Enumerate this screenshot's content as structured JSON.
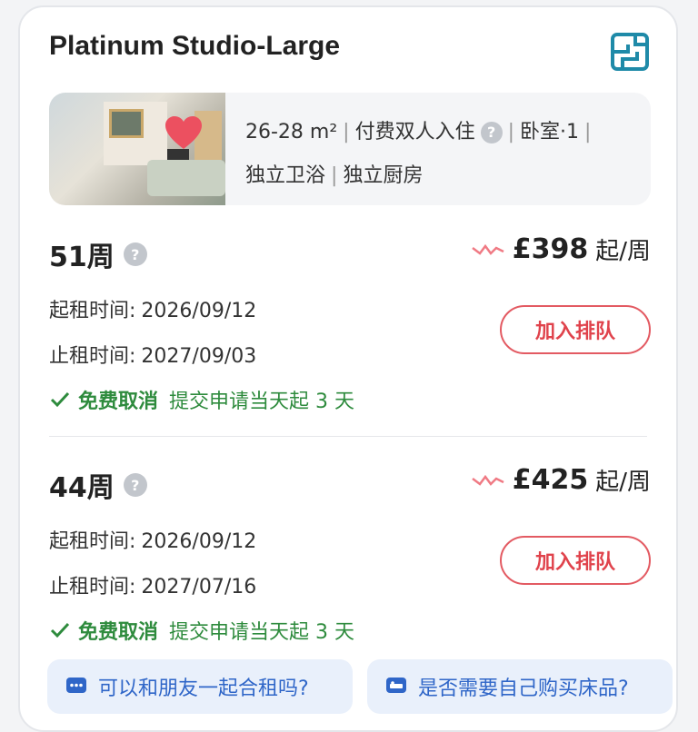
{
  "room": {
    "title": "Platinum Studio-Large",
    "floorplan_icon": "floorplan-icon",
    "favorite_icon": "heart-icon",
    "info_line1": {
      "area": "26-28 m²",
      "occupancy": "付费双人入住",
      "bedroom": "卧室·1"
    },
    "info_line2": {
      "bathroom": "独立卫浴",
      "kitchen": "独立厨房"
    }
  },
  "plans": [
    {
      "weeks": "51周",
      "price": "£398",
      "unit": "起/周",
      "start_label": "起租时间:",
      "start_date": "2026/09/12",
      "end_label": "止租时间:",
      "end_date": "2027/09/03",
      "cancel_title": "免费取消",
      "cancel_desc": "提交申请当天起 3 天",
      "button": "加入排队"
    },
    {
      "weeks": "44周",
      "price": "£425",
      "unit": "起/周",
      "start_label": "起租时间:",
      "start_date": "2026/09/12",
      "end_label": "止租时间:",
      "end_date": "2027/07/16",
      "cancel_title": "免费取消",
      "cancel_desc": "提交申请当天起 3 天",
      "button": "加入排队"
    }
  ],
  "faq": {
    "left": "可以和朋友一起合租吗?",
    "right": "是否需要自己购买床品?"
  },
  "colors": {
    "accent_red": "#e0434c",
    "green": "#2e8b3d",
    "link_blue": "#2f66c8",
    "floorplan_teal": "#1f8aa8"
  }
}
